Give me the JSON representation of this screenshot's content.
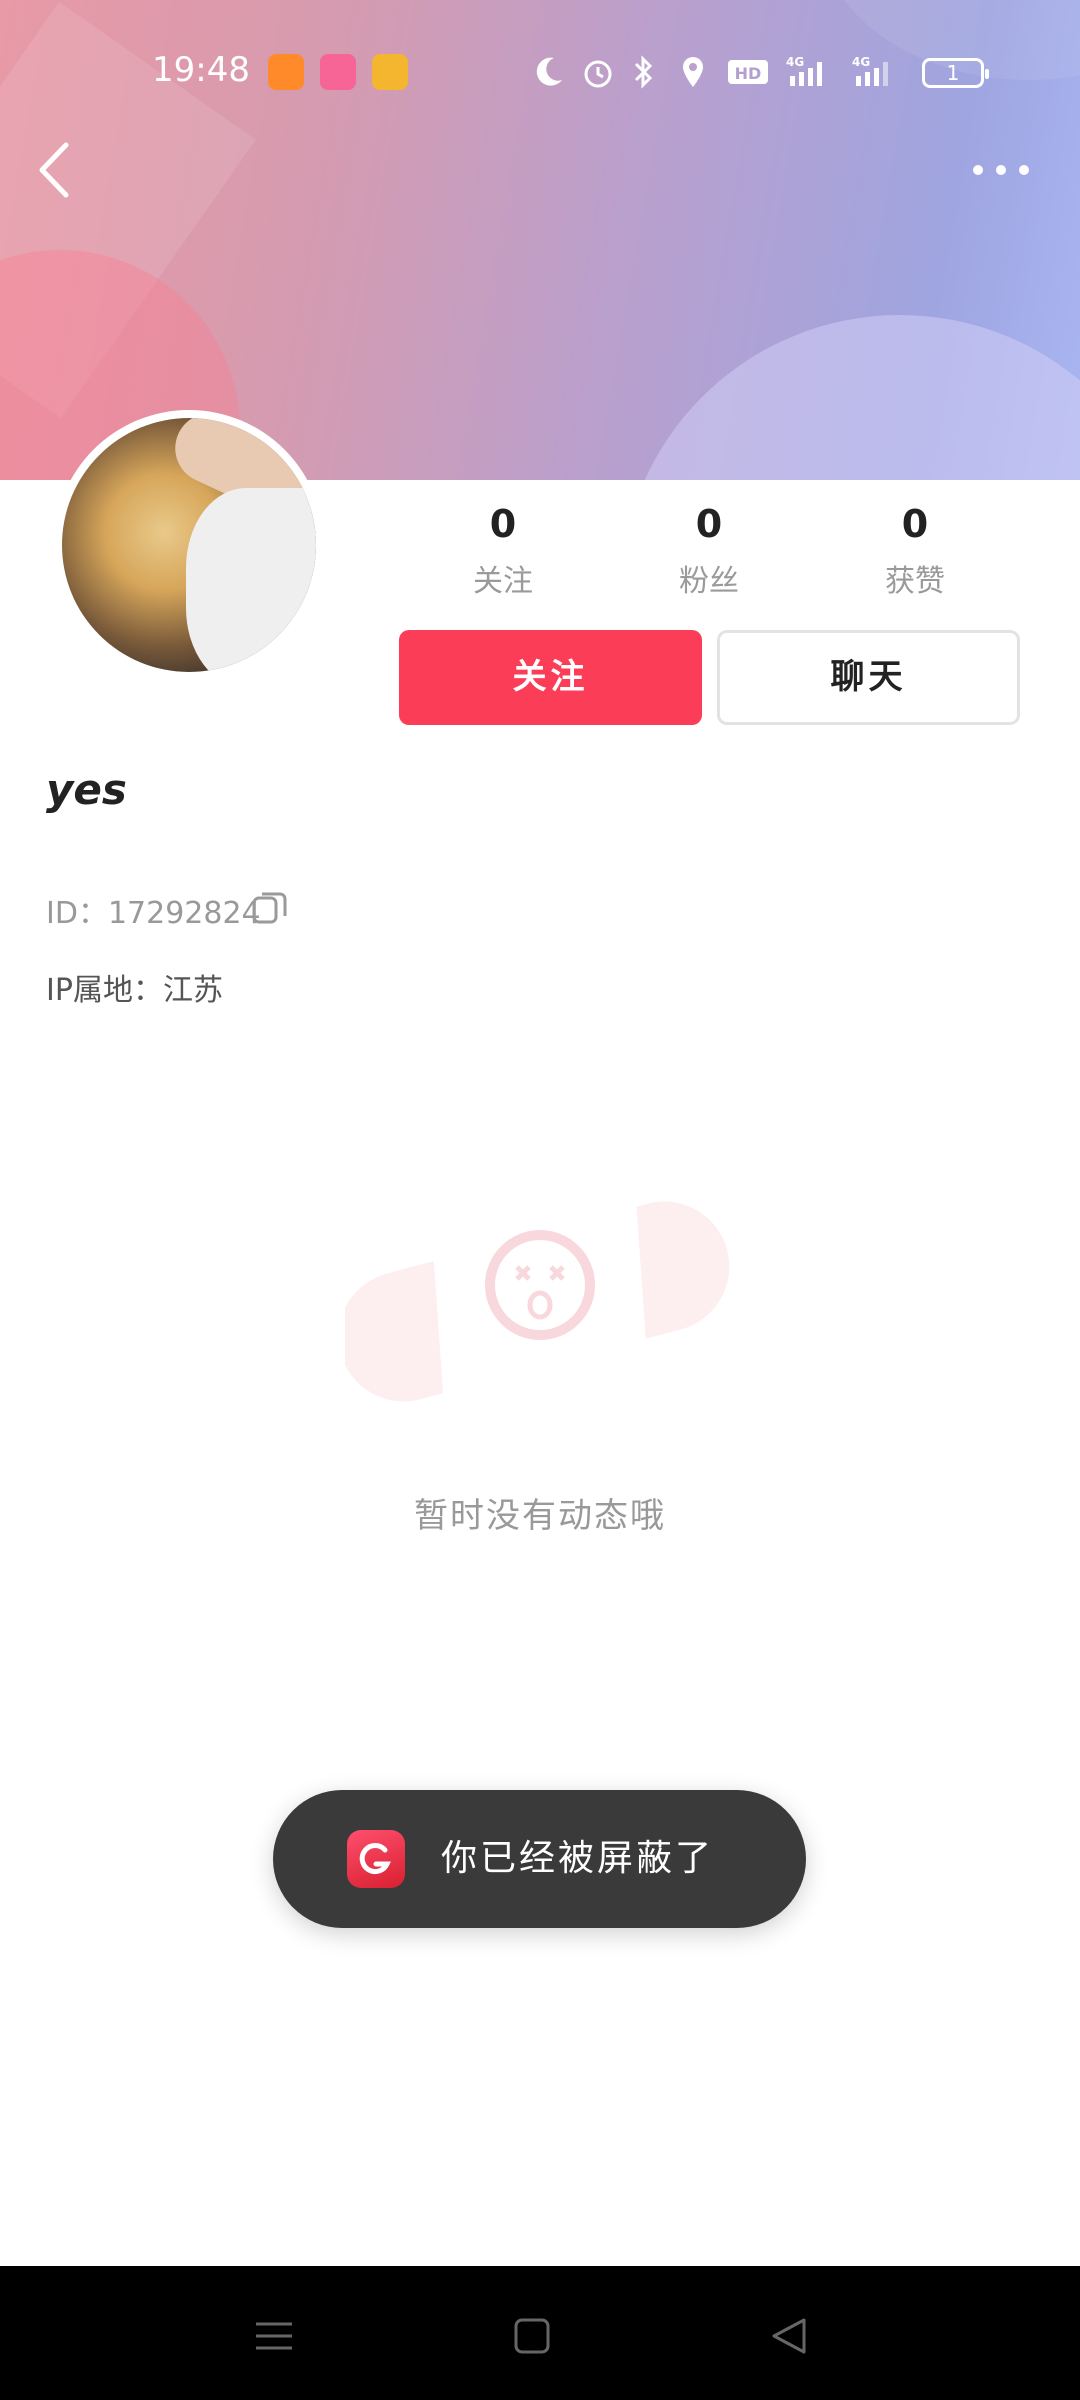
{
  "status_bar": {
    "time": "19:48",
    "battery": "1",
    "network": "4G"
  },
  "profile": {
    "username": "yes",
    "id_label": "ID：",
    "id_value": "17292824",
    "ip_label": "IP属地：",
    "ip_value": "江苏"
  },
  "stats": [
    {
      "value": "0",
      "label": "关注"
    },
    {
      "value": "0",
      "label": "粉丝"
    },
    {
      "value": "0",
      "label": "获赞"
    }
  ],
  "actions": {
    "follow_label": "关注",
    "chat_label": "聊天"
  },
  "empty_state": {
    "message": "暂时没有动态哦"
  },
  "toast": {
    "message": "你已经被屏蔽了"
  },
  "colors": {
    "accent": "#fc3d57",
    "toast_bg": "#3a3a3a"
  },
  "icons": {
    "back": "chevron-left-icon",
    "more": "more-dots-icon",
    "copy": "copy-icon"
  }
}
